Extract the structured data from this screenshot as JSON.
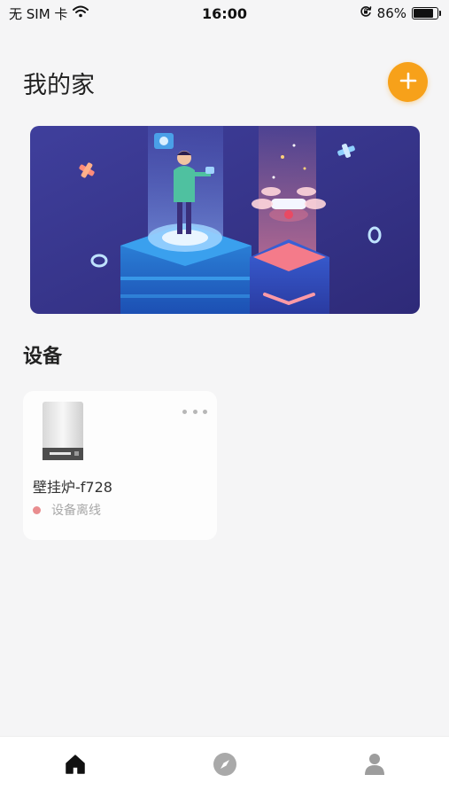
{
  "status_bar": {
    "carrier": "无 SIM 卡",
    "time": "16:00",
    "battery_percent": "86%",
    "battery_level": 0.86,
    "icons": [
      "wifi-icon",
      "orientation-lock-icon",
      "battery-icon"
    ]
  },
  "header": {
    "title": "我的家",
    "add_icon": "plus-icon",
    "accent_color": "#f7a11a"
  },
  "banner": {
    "icon": "smart-home-illustration"
  },
  "devices_section": {
    "title": "设备",
    "devices": [
      {
        "name": "壁挂炉-f728",
        "status": "设备离线",
        "status_color": "#e98d8f",
        "more_icon": "more-dots-icon",
        "image_icon": "wall-boiler-icon"
      }
    ]
  },
  "tab_bar": {
    "tabs": [
      {
        "icon": "home-icon",
        "active": true
      },
      {
        "icon": "compass-icon",
        "active": false
      },
      {
        "icon": "user-icon",
        "active": false
      }
    ]
  }
}
